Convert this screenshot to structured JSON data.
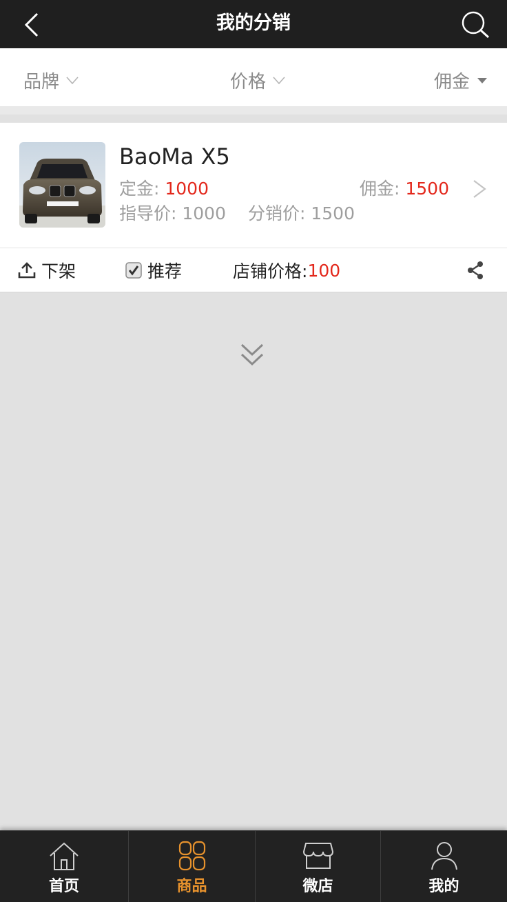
{
  "header": {
    "title": "我的分销",
    "back_icon": "chevron-left-icon",
    "search_icon": "search-icon"
  },
  "filters": [
    {
      "label": "品牌",
      "icon": "chevron-down-outline-icon"
    },
    {
      "label": "价格",
      "icon": "chevron-down-outline-icon"
    },
    {
      "label": "佣金",
      "icon": "triangle-down-icon"
    }
  ],
  "product": {
    "name": "BaoMa X5",
    "deposit_label": "定金: ",
    "deposit_value": "1000",
    "commission_label": "佣金: ",
    "commission_value": "1500",
    "guide_price": "指导价: 1000",
    "distribution_price": "分销价: 1500"
  },
  "actions": {
    "delist_label": "下架",
    "recommend_label": "推荐",
    "recommend_checked": true,
    "store_price_label": "店铺价格: ",
    "store_price_value": "100"
  },
  "colors": {
    "accent": "#e7922d",
    "price_red": "#e3281c",
    "header_bg": "#1f1f1f"
  },
  "tabbar": {
    "items": [
      {
        "label": "首页",
        "icon": "home-icon"
      },
      {
        "label": "商品",
        "icon": "grid-icon",
        "active": true
      },
      {
        "label": "微店",
        "icon": "store-icon"
      },
      {
        "label": "我的",
        "icon": "user-icon"
      }
    ]
  }
}
